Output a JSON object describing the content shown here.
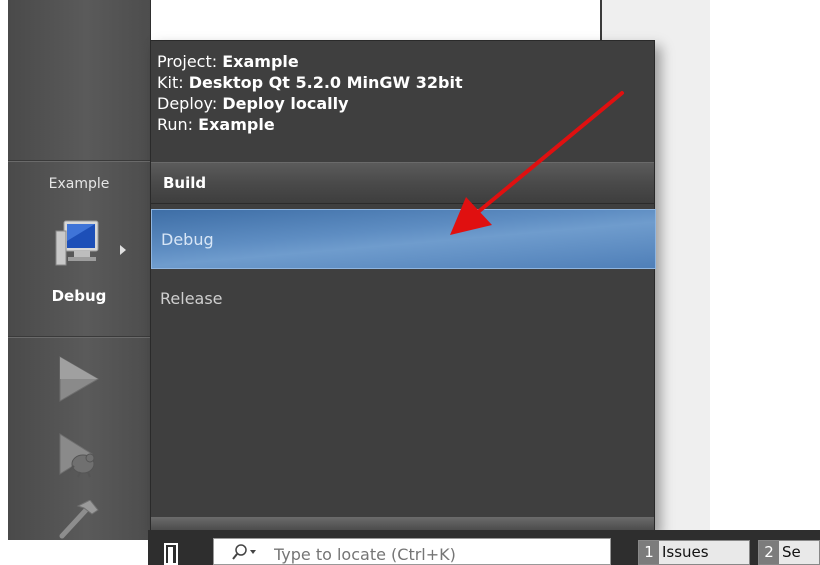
{
  "project_info": {
    "project_label": "Project:",
    "project_value": "Example",
    "kit_label": "Kit:",
    "kit_value": "Desktop Qt 5.2.0 MinGW 32bit",
    "deploy_label": "Deploy:",
    "deploy_value": "Deploy locally",
    "run_label": "Run:",
    "run_value": "Example"
  },
  "build": {
    "header": "Build",
    "options": [
      "Debug",
      "Release"
    ],
    "selected": "Debug"
  },
  "sidebar": {
    "project_name": "Example",
    "build_mode": "Debug",
    "icons": [
      "computer-monitor-icon",
      "run-icon",
      "debug-run-icon",
      "build-hammer-icon"
    ]
  },
  "statusbar": {
    "locate_placeholder": "Type to locate (Ctrl+K)",
    "tabs": [
      {
        "num": "1",
        "label": "Issues"
      },
      {
        "num": "2",
        "label": "Se"
      }
    ]
  },
  "colors": {
    "selection": "#5e8dc2",
    "arrow": "#e01010",
    "popup_bg": "#3f3f3f"
  }
}
